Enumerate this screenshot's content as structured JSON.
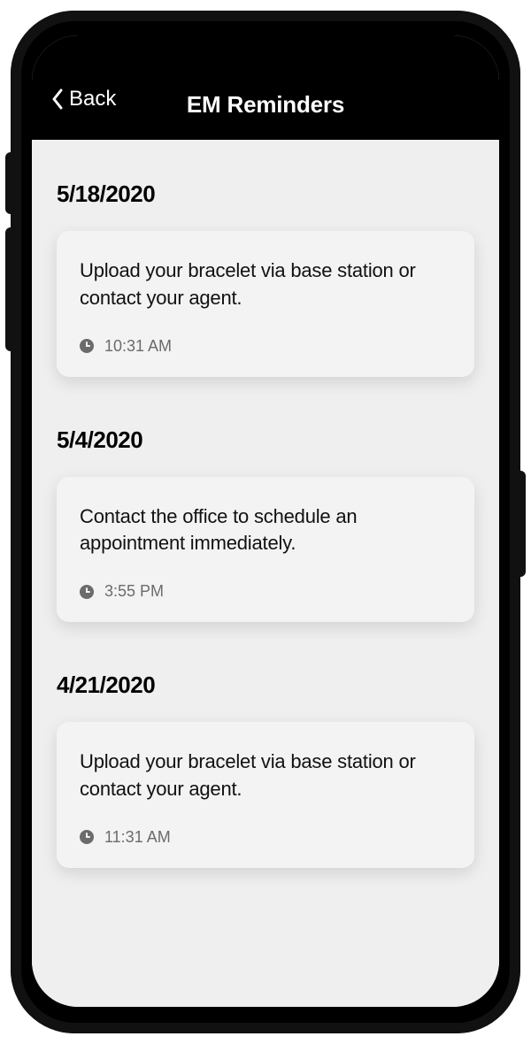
{
  "navbar": {
    "back_label": "Back",
    "title": "EM Reminders"
  },
  "reminders": [
    {
      "date": "5/18/2020",
      "message": "Upload your bracelet via base station or contact your agent.",
      "time": "10:31 AM"
    },
    {
      "date": "5/4/2020",
      "message": "Contact the office to schedule an appointment immediately.",
      "time": "3:55 PM"
    },
    {
      "date": "4/21/2020",
      "message": "Upload your bracelet via base station or contact your agent.",
      "time": "11:31 AM"
    }
  ]
}
